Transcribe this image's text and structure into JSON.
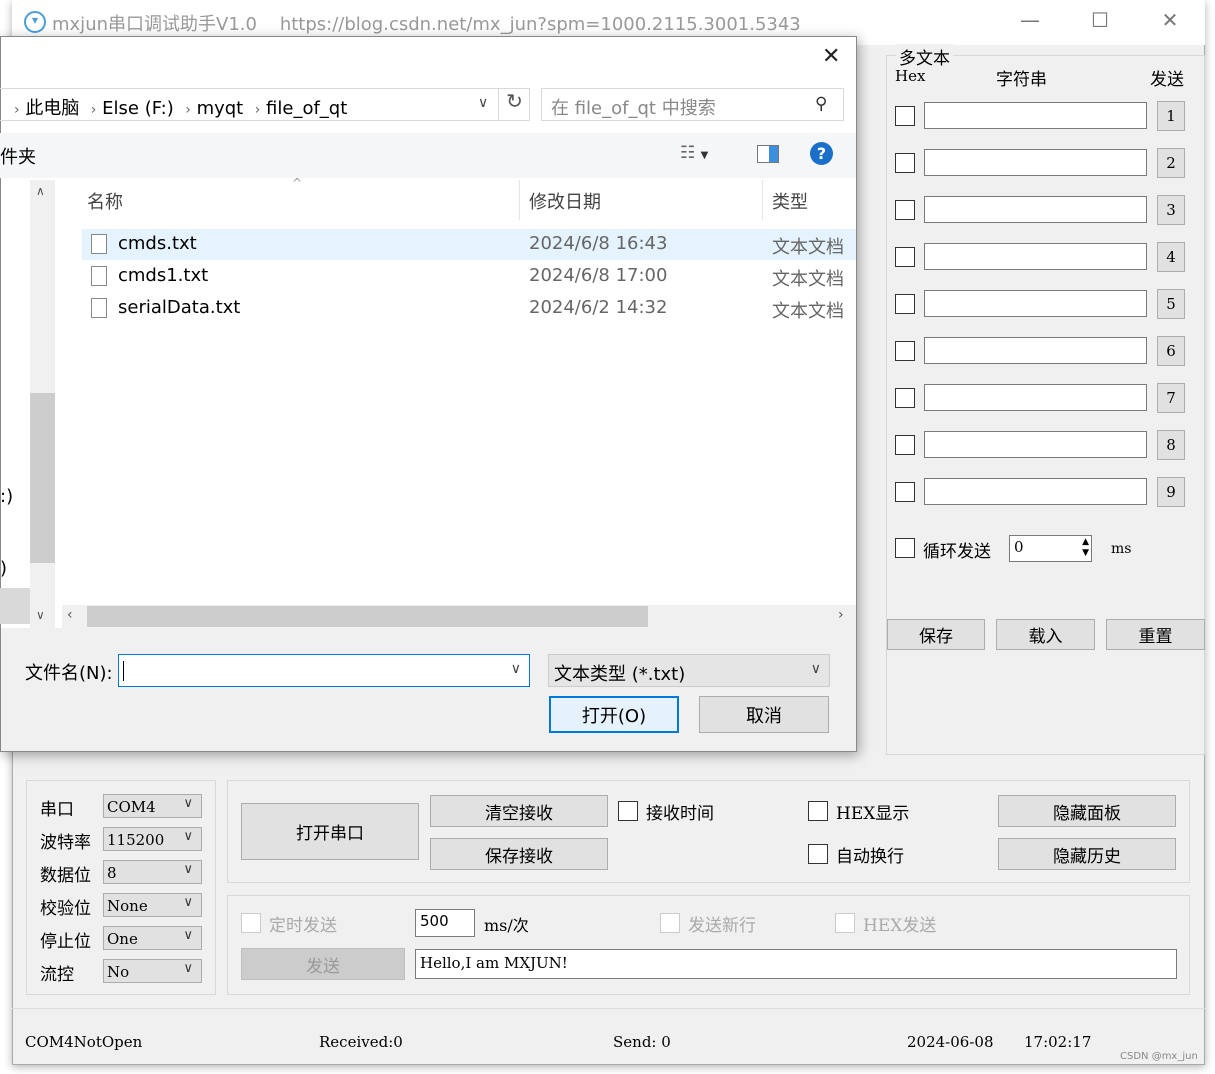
{
  "app": {
    "title": "mxjun串口调试助手V1.0",
    "url": "https://blog.csdn.net/mx_jun?spm=1000.2115.3001.5343",
    "min": "—",
    "max": "☐",
    "close": "✕"
  },
  "multi": {
    "title": "多文本",
    "hex": "Hex",
    "string": "字符串",
    "send": "发送",
    "rows": [
      {
        "n": "1"
      },
      {
        "n": "2"
      },
      {
        "n": "3"
      },
      {
        "n": "4"
      },
      {
        "n": "5"
      },
      {
        "n": "6"
      },
      {
        "n": "7"
      },
      {
        "n": "8"
      },
      {
        "n": "9"
      }
    ],
    "loop_label": "循环发送",
    "loop_value": "0",
    "ms": "ms",
    "save": "保存",
    "load": "载入",
    "reset": "重置"
  },
  "serial": {
    "labels": [
      "串口",
      "波特率",
      "数据位",
      "校验位",
      "停止位",
      "流控"
    ],
    "values": [
      "COM4",
      "115200",
      "8",
      "None",
      "One",
      "No"
    ]
  },
  "ctrl": {
    "open": "打开串口",
    "clear": "清空接收",
    "save_recv": "保存接收",
    "recv_time": "接收时间",
    "hex_show": "HEX显示",
    "auto_wrap": "自动换行",
    "hide_panel": "隐藏面板",
    "hide_history": "隐藏历史"
  },
  "send": {
    "timed": "定时发送",
    "interval": "500",
    "unit": "ms/次",
    "newline": "发送新行",
    "hex_send": "HEX发送",
    "send_btn": "发送",
    "text": "Hello,I am MXJUN!"
  },
  "status": {
    "port": "COM4NotOpen",
    "received": "Received:0",
    "sent": "Send: 0",
    "date": "2024-06-08",
    "time": "17:02:17",
    "watermark": "CSDN @mx_jun"
  },
  "dialog": {
    "close": "✕",
    "path": [
      "此电脑",
      "Else (F:)",
      "myqt",
      "file_of_qt"
    ],
    "search_placeholder": "在 file_of_qt 中搜索",
    "folder_label": "件夹",
    "columns": [
      "名称",
      "修改日期",
      "类型"
    ],
    "files": [
      {
        "name": "cmds.txt",
        "date": "2024/6/8 16:43",
        "type": "文本文档"
      },
      {
        "name": "cmds1.txt",
        "date": "2024/6/8 17:00",
        "type": "文本文档"
      },
      {
        "name": "serialData.txt",
        "date": "2024/6/2 14:32",
        "type": "文本文档"
      }
    ],
    "nav_fragments": [
      ":)",
      ")"
    ],
    "filename_label": "文件名(N):",
    "filename": "",
    "filter": "文本类型 (*.txt)",
    "open": "打开(O)",
    "cancel": "取消"
  }
}
